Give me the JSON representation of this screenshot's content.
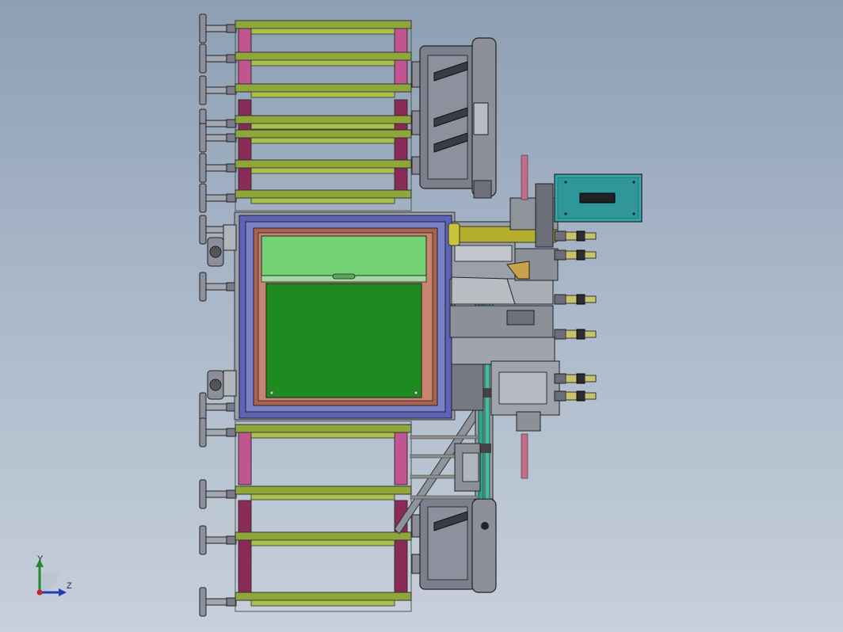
{
  "view": {
    "name": "cad-model-viewport",
    "background_top": "#8d9fb4",
    "background_bottom": "#c7d0db"
  },
  "triad": {
    "y_label": "Y",
    "z_label": "Z",
    "x_color": "#c62828",
    "y_color": "#1e8c2e",
    "z_color": "#1f3fb0"
  },
  "colors": {
    "frame_green": "#8fa63a",
    "frame_magenta": "#c2548f",
    "frame_maroon": "#8a2a56",
    "box_blue": "#5c63b8",
    "box_brown": "#a8624e",
    "panel_green": "#1f8a1f",
    "panel_light_green": "#73d073",
    "motor_grey": "#7c7f8c",
    "teal_box": "#36a6a8",
    "rod_yellow": "#b5ad2e",
    "steel": "#9aa0aa"
  }
}
